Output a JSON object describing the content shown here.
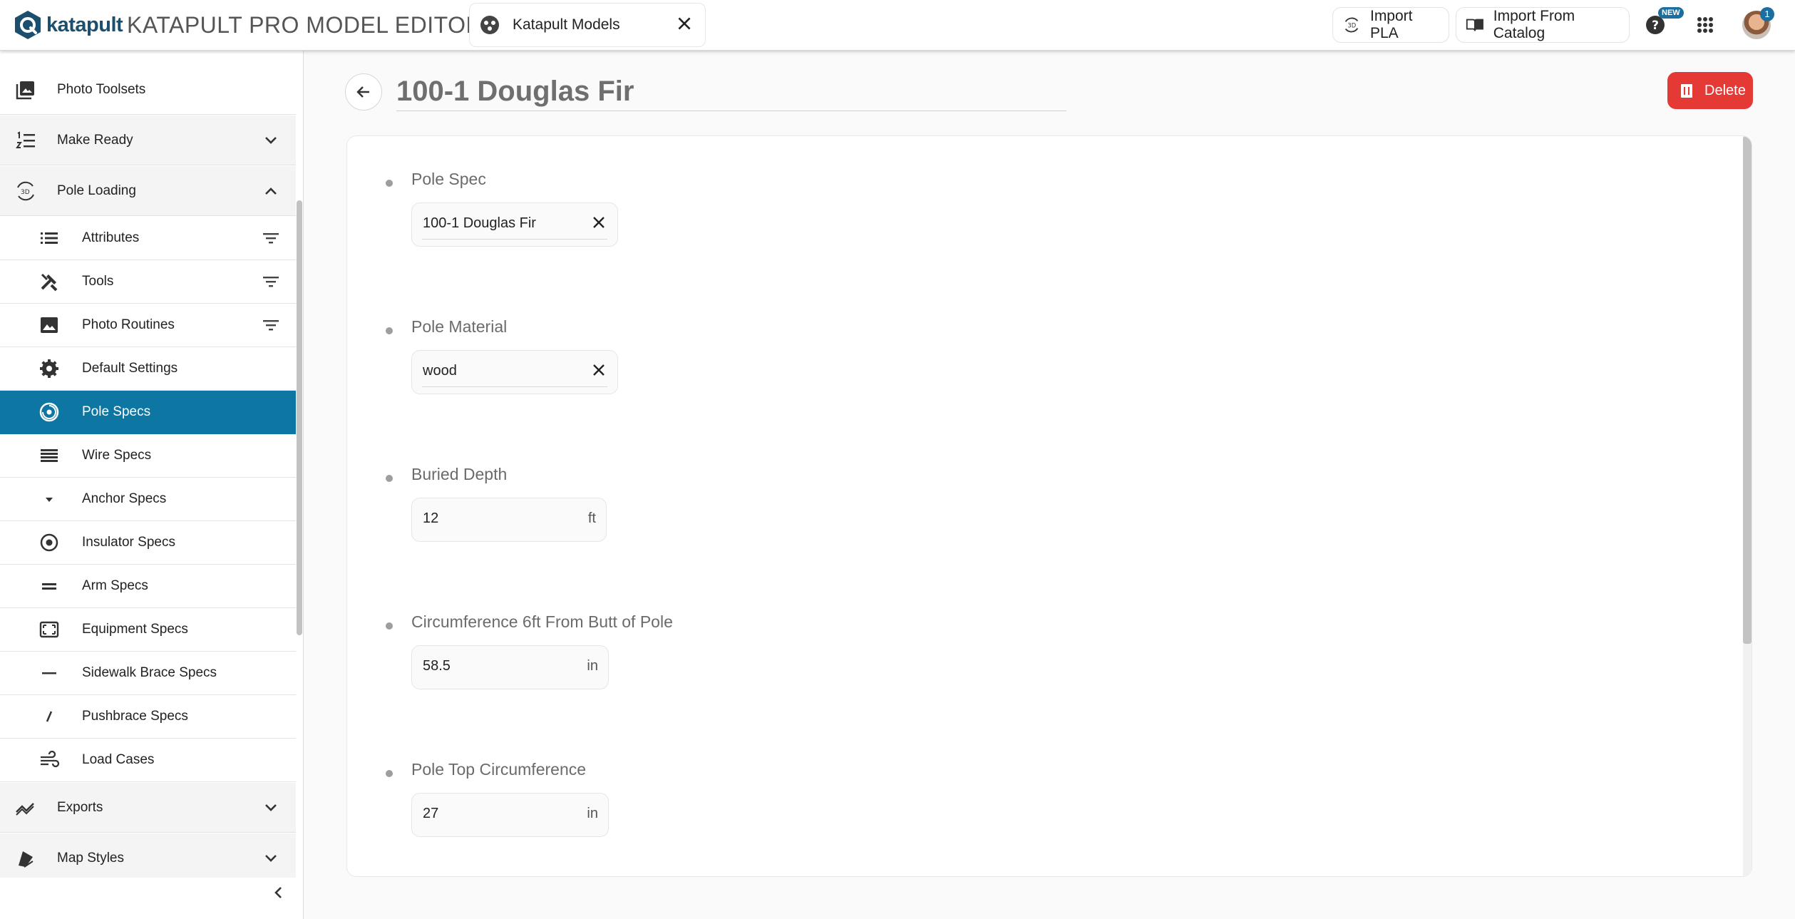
{
  "header": {
    "logo_text": "katapult",
    "app_title": "KATAPULT PRO MODEL EDITOR",
    "model_chip_label": "Katapult Models",
    "import_pla_label": "Import PLA",
    "import_catalog_label": "Import From Catalog",
    "new_badge": "NEW",
    "notification_count": "1"
  },
  "sidebar": {
    "sections": [
      {
        "label": "Photo Toolsets",
        "icon": "photo-library-icon"
      },
      {
        "label": "Make Ready",
        "icon": "format-list-numbered-icon",
        "expanded": false
      },
      {
        "label": "Pole Loading",
        "icon": "3d-rotation-icon",
        "expanded": true
      },
      {
        "label": "Exports",
        "icon": "trending-icon",
        "expanded": false
      },
      {
        "label": "Map Styles",
        "icon": "paint-bucket-icon",
        "expanded": false
      }
    ],
    "pole_loading_items": [
      {
        "label": "Attributes",
        "icon": "list-icon",
        "filter": true
      },
      {
        "label": "Tools",
        "icon": "tools-icon",
        "filter": true
      },
      {
        "label": "Photo Routines",
        "icon": "image-icon",
        "filter": true
      },
      {
        "label": "Default Settings",
        "icon": "gear-icon"
      },
      {
        "label": "Pole Specs",
        "icon": "pole-top-icon",
        "active": true
      },
      {
        "label": "Wire Specs",
        "icon": "wire-lines-icon"
      },
      {
        "label": "Anchor Specs",
        "icon": "anchor-arrow-icon"
      },
      {
        "label": "Insulator Specs",
        "icon": "insulator-circle-icon"
      },
      {
        "label": "Arm Specs",
        "icon": "arm-equals-icon"
      },
      {
        "label": "Equipment Specs",
        "icon": "equipment-frame-icon"
      },
      {
        "label": "Sidewalk Brace Specs",
        "icon": "dash-icon"
      },
      {
        "label": "Pushbrace Specs",
        "icon": "slash-icon"
      },
      {
        "label": "Load Cases",
        "icon": "wind-icon"
      }
    ]
  },
  "main": {
    "title": "100-1 Douglas Fir",
    "delete_label": "Delete",
    "fields": [
      {
        "label": "Pole Spec",
        "value": "100-1 Douglas Fir",
        "clearable": true
      },
      {
        "label": "Pole Material",
        "value": "wood",
        "clearable": true
      },
      {
        "label": "Buried Depth",
        "value": "12",
        "unit": "ft"
      },
      {
        "label": "Circumference 6ft From Butt of Pole",
        "value": "58.5",
        "unit": "in"
      },
      {
        "label": "Pole Top Circumference",
        "value": "27",
        "unit": "in"
      }
    ]
  },
  "colors": {
    "brand_blue": "#1c4f6e",
    "active_item": "#0e76a3",
    "delete_red": "#e53935",
    "badge_blue": "#1a6fa0"
  }
}
